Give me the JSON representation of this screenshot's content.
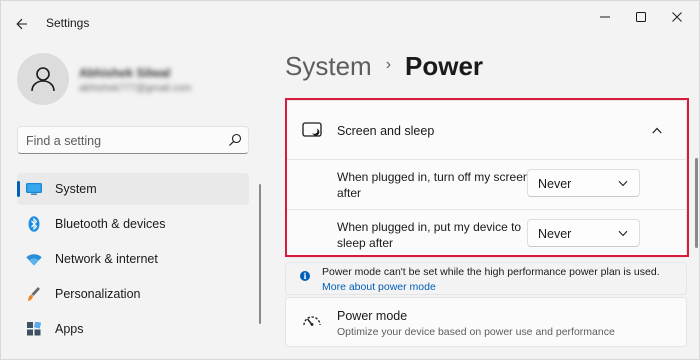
{
  "window": {
    "app_title": "Settings",
    "controls": [
      "minimize-icon",
      "maximize-icon",
      "close-icon"
    ]
  },
  "profile": {
    "name": "Abhishek Silwal",
    "email": "abhishek777@gmail.com"
  },
  "search": {
    "placeholder": "Find a setting"
  },
  "sidebar": {
    "items": [
      {
        "label": "System",
        "icon": "monitor-icon",
        "active": true
      },
      {
        "label": "Bluetooth & devices",
        "icon": "bluetooth-icon",
        "active": false
      },
      {
        "label": "Network & internet",
        "icon": "wifi-icon",
        "active": false
      },
      {
        "label": "Personalization",
        "icon": "brush-icon",
        "active": false
      },
      {
        "label": "Apps",
        "icon": "apps-icon",
        "active": false
      }
    ]
  },
  "breadcrumb": {
    "parent": "System",
    "separator": "›",
    "current": "Power"
  },
  "screen_sleep": {
    "title": "Screen and sleep",
    "rows": [
      {
        "label": "When plugged in, turn off my screen after",
        "value": "Never"
      },
      {
        "label": "When plugged in, put my device to sleep after",
        "value": "Never"
      }
    ]
  },
  "info": {
    "text": "Power mode can't be set while the high performance power plan is used.",
    "link": "More about power mode"
  },
  "power_mode": {
    "title": "Power mode",
    "description": "Optimize your device based on power use and performance"
  },
  "colors": {
    "accent": "#005fb8",
    "highlight": "#d81a3c",
    "background": "#f3f3f3",
    "card": "#fbfbfb"
  }
}
